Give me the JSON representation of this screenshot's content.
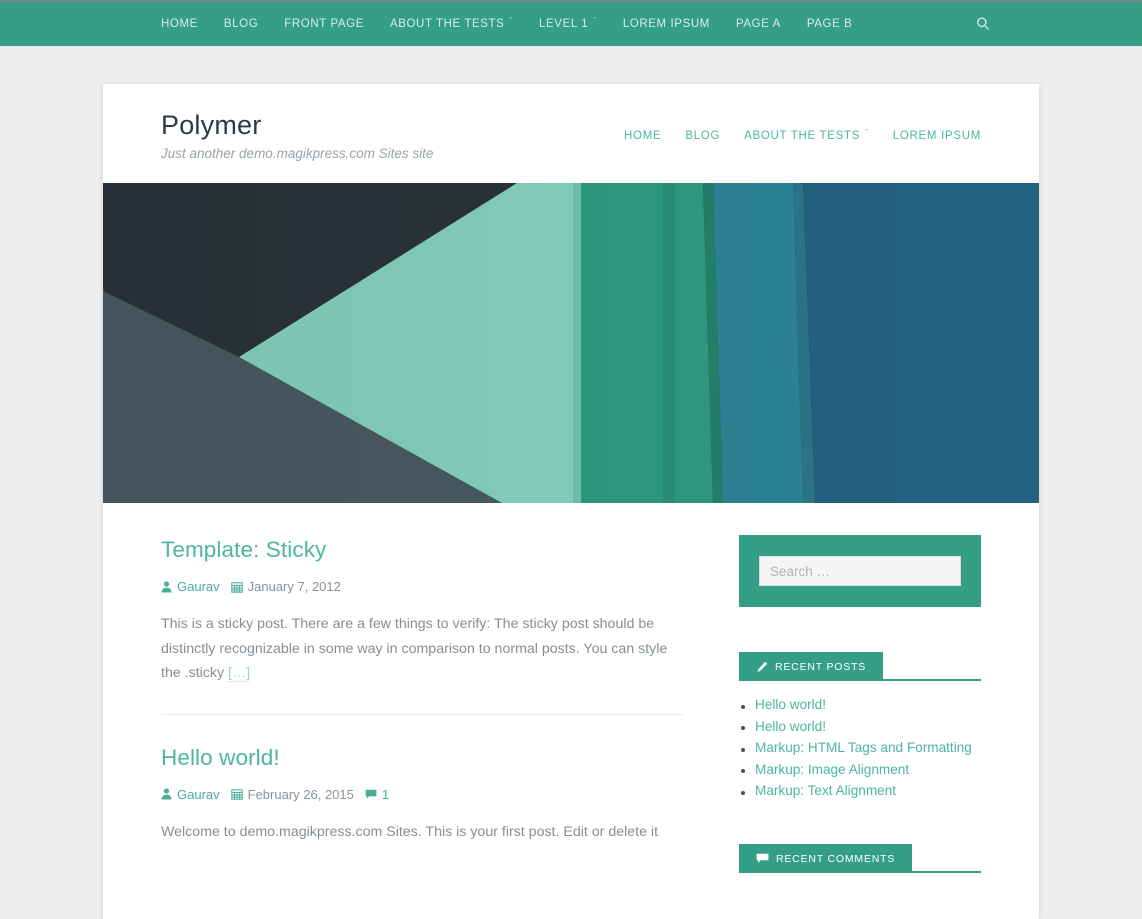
{
  "theme": {
    "accent": "#349e87",
    "link": "#4db6a0",
    "page_bg": "#eeeeee",
    "card_bg": "#ffffff",
    "text_muted": "#868e95",
    "heading": "#2f3b42"
  },
  "topbar": {
    "items": [
      {
        "label": "HOME",
        "has_dropdown": false
      },
      {
        "label": "BLOG",
        "has_dropdown": false
      },
      {
        "label": "FRONT PAGE",
        "has_dropdown": false
      },
      {
        "label": "ABOUT THE TESTS",
        "has_dropdown": true
      },
      {
        "label": "LEVEL 1",
        "has_dropdown": true
      },
      {
        "label": "LOREM IPSUM",
        "has_dropdown": false
      },
      {
        "label": "PAGE A",
        "has_dropdown": false
      },
      {
        "label": "PAGE B",
        "has_dropdown": false
      }
    ],
    "search_icon": "search-icon"
  },
  "header": {
    "site_title": "Polymer",
    "site_description": "Just another demo.magikpress.com Sites site",
    "nav": [
      {
        "label": "HOME",
        "has_dropdown": false
      },
      {
        "label": "BLOG",
        "has_dropdown": false
      },
      {
        "label": "ABOUT THE TESTS",
        "has_dropdown": true
      },
      {
        "label": "LOREM IPSUM",
        "has_dropdown": false
      }
    ]
  },
  "hero": {
    "alt": "abstract geometric material design banner",
    "colors": {
      "dark_slate": "#2a3438",
      "grey_blue": "#4a5a63",
      "mint": "#86d2bf",
      "green": "#2d9b7f",
      "teal": "#2d8396",
      "blue": "#246180"
    }
  },
  "posts": [
    {
      "title": "Template: Sticky",
      "author": "Gaurav",
      "author_icon": "user-icon",
      "date": "January 7, 2012",
      "date_icon": "calendar-icon",
      "comments": null,
      "comments_icon": "comment-icon",
      "excerpt": "This is a sticky post. There are a few things to verify: The sticky post should be distinctly recognizable in some way in comparison to normal posts. You can style the .sticky ",
      "more_label": "[…]"
    },
    {
      "title": "Hello world!",
      "author": "Gaurav",
      "author_icon": "user-icon",
      "date": "February 26, 2015",
      "date_icon": "calendar-icon",
      "comments": "1",
      "comments_icon": "comment-icon",
      "excerpt": "Welcome to demo.magikpress.com Sites. This is your first post. Edit or delete it",
      "more_label": ""
    }
  ],
  "sidebar": {
    "search": {
      "placeholder": "Search …",
      "value": ""
    },
    "widgets": [
      {
        "title": "RECENT POSTS",
        "icon": "pencil-icon",
        "items": [
          "Hello world!",
          "Hello world!",
          "Markup: HTML Tags and Formatting",
          "Markup: Image Alignment",
          "Markup: Text Alignment"
        ]
      },
      {
        "title": "RECENT COMMENTS",
        "icon": "comment-icon",
        "items": []
      }
    ]
  }
}
